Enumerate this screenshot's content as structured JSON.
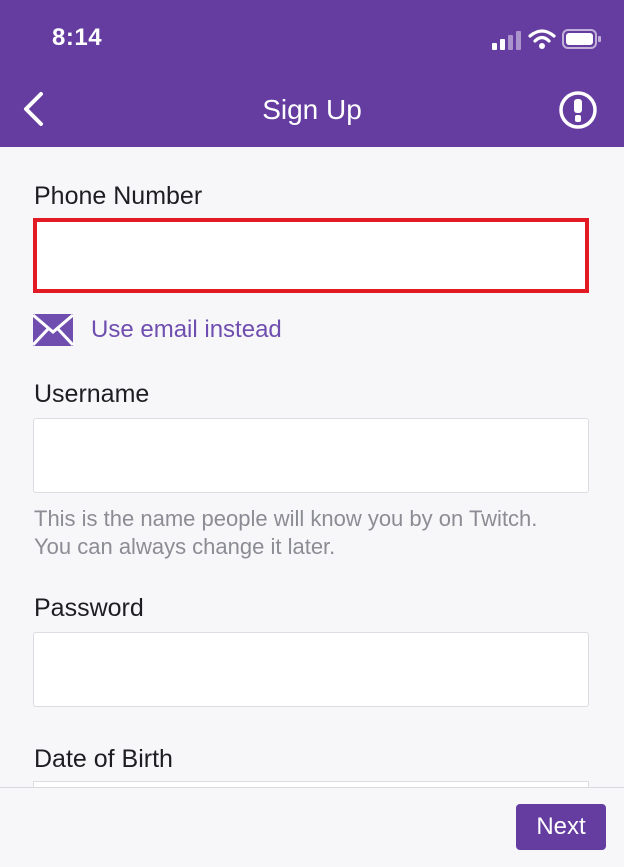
{
  "status_bar": {
    "time": "8:14",
    "icons": [
      "cellular-signal-icon",
      "wifi-icon",
      "battery-icon"
    ]
  },
  "nav": {
    "title": "Sign Up",
    "back_icon": "chevron-left-icon",
    "info_icon": "info-exclamation-icon"
  },
  "form": {
    "phone": {
      "label": "Phone Number",
      "value": "",
      "placeholder": ""
    },
    "use_email": {
      "label": "Use email instead",
      "icon": "mail-icon"
    },
    "username": {
      "label": "Username",
      "value": "",
      "placeholder": "",
      "helper_line1": "This is the name people will know you by on Twitch.",
      "helper_line2": "You can always change it later."
    },
    "password": {
      "label": "Password",
      "value": "",
      "placeholder": ""
    },
    "dob": {
      "label": "Date of Birth"
    }
  },
  "footer": {
    "next_label": "Next"
  },
  "colors": {
    "brand": "#653da0",
    "link": "#6f4eb0",
    "highlight": "#e21a24",
    "background": "#f7f7f9"
  }
}
